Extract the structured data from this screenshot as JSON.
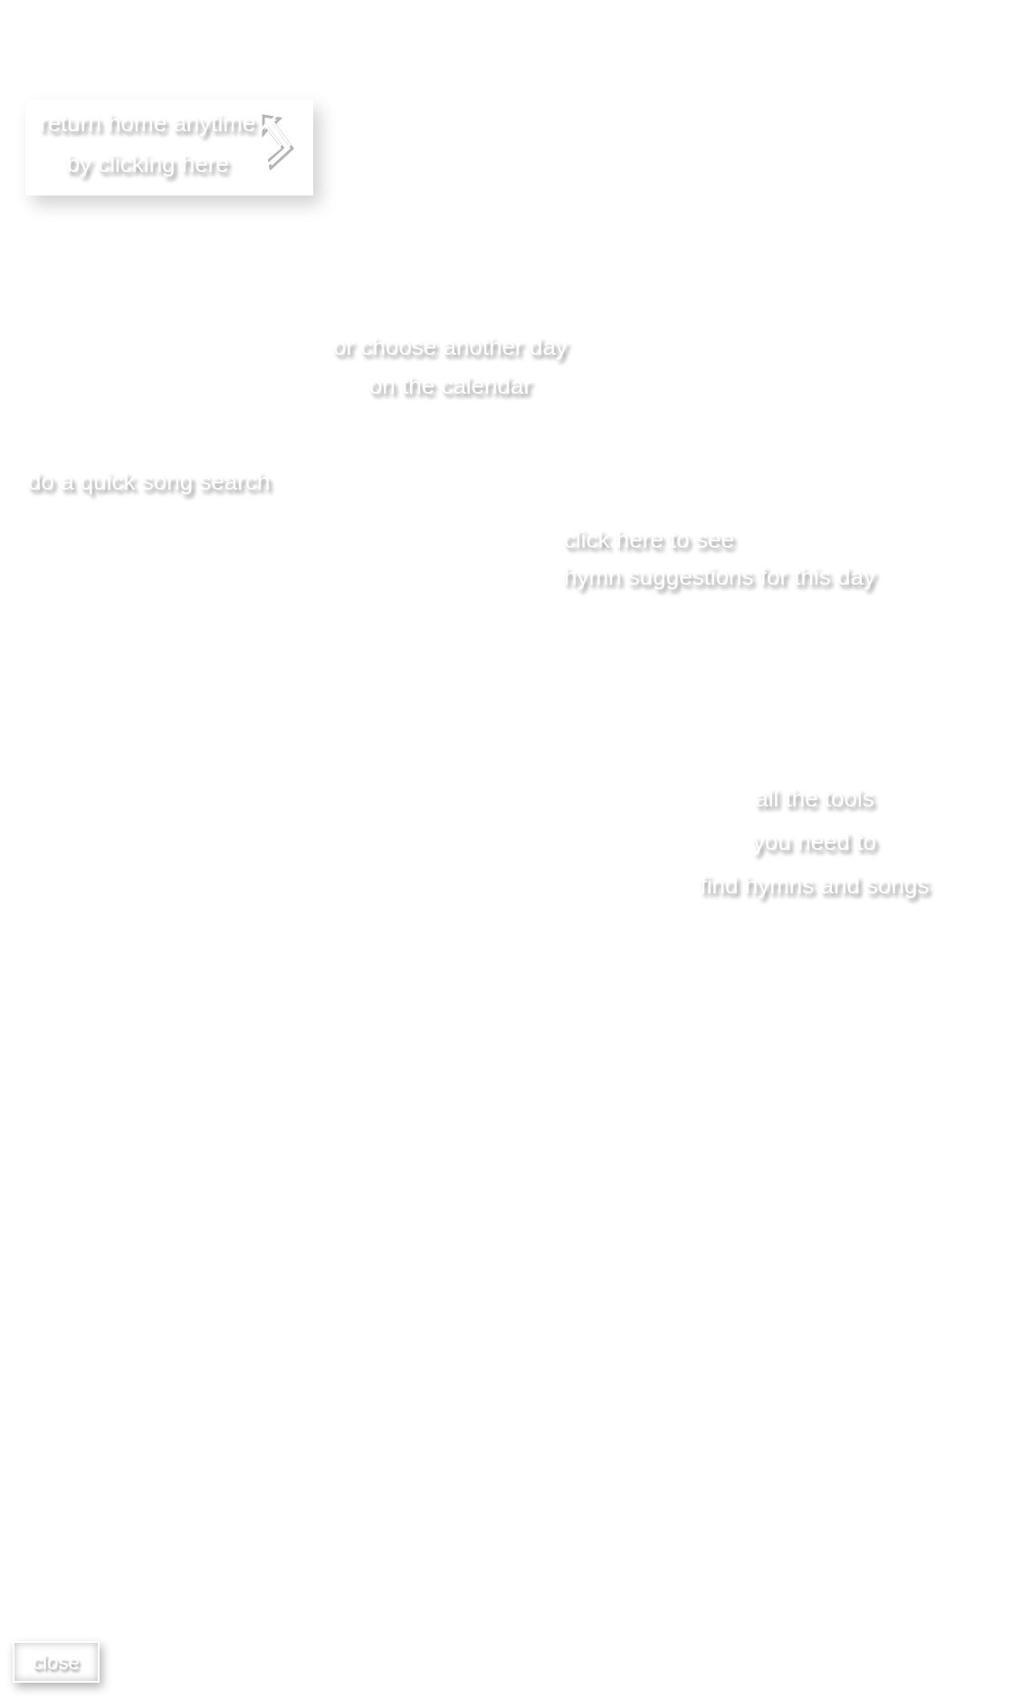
{
  "callouts": [
    {
      "kind": "arrow_panel",
      "lines": [
        "return home anytime",
        "by clicking here"
      ]
    },
    {
      "kind": "plain",
      "lines": [
        "or choose another day",
        "on the calendar"
      ]
    },
    {
      "kind": "plain",
      "lines": [
        "do a quick song search"
      ]
    },
    {
      "kind": "plain",
      "lines": [
        "click here to see",
        "hymn suggestions for this day"
      ]
    },
    {
      "kind": "plain",
      "lines": [
        "all the tools",
        "you need to",
        "find hymns and songs"
      ]
    }
  ],
  "close_button": {
    "label": "close"
  }
}
